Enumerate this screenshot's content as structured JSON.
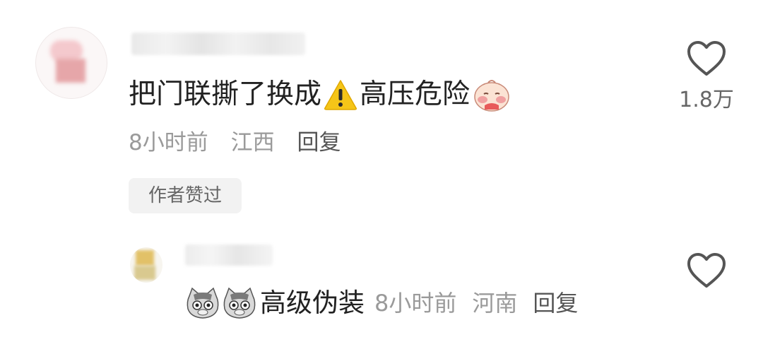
{
  "comments": [
    {
      "text": "把门联撕了换成",
      "text_after_icon": "高压危险",
      "inline_icons": [
        "warning-icon",
        "blush-face-icon"
      ],
      "time": "8小时前",
      "location": "江西",
      "reply_label": "回复",
      "author_liked_badge": "作者赞过",
      "like_count": "1.8万",
      "like_icon": "heart-outline-icon"
    },
    {
      "inline_icons": [
        "cat-emoji-icon",
        "cat-emoji-icon"
      ],
      "text": "高级伪装",
      "time": "8小时前",
      "location": "河南",
      "reply_label": "回复",
      "like_icon": "heart-outline-icon"
    }
  ],
  "colors": {
    "text_primary": "#222222",
    "text_secondary": "#9a9a9a",
    "reply": "#555555",
    "badge_bg": "#f2f2f2",
    "warning_yellow": "#f5c518"
  }
}
